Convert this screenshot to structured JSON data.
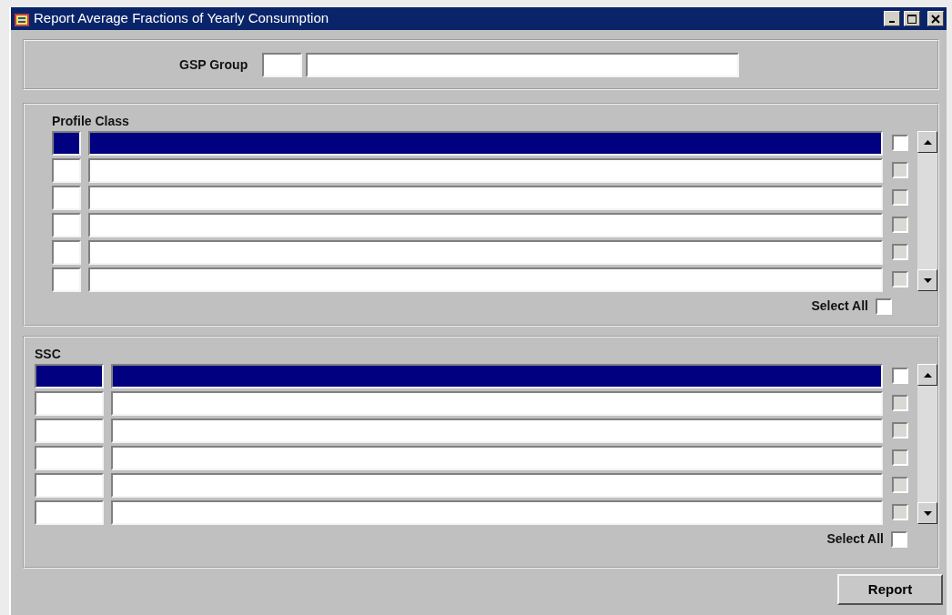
{
  "window": {
    "title": "Report Average Fractions of Yearly Consumption"
  },
  "gsp_group": {
    "label": "GSP Group"
  },
  "profile_class": {
    "label": "Profile Class",
    "rows": [
      {
        "selected": true,
        "checked": false,
        "disabled": false
      },
      {
        "selected": false,
        "checked": false,
        "disabled": true
      },
      {
        "selected": false,
        "checked": false,
        "disabled": true
      },
      {
        "selected": false,
        "checked": false,
        "disabled": true
      },
      {
        "selected": false,
        "checked": false,
        "disabled": true
      },
      {
        "selected": false,
        "checked": false,
        "disabled": true
      }
    ],
    "select_all": {
      "label": "Select All",
      "checked": false
    }
  },
  "ssc": {
    "label": "SSC",
    "rows": [
      {
        "selected": true,
        "checked": false,
        "disabled": false
      },
      {
        "selected": false,
        "checked": false,
        "disabled": true
      },
      {
        "selected": false,
        "checked": false,
        "disabled": true
      },
      {
        "selected": false,
        "checked": false,
        "disabled": true
      },
      {
        "selected": false,
        "checked": false,
        "disabled": true
      },
      {
        "selected": false,
        "checked": false,
        "disabled": true
      }
    ],
    "select_all": {
      "label": "Select All",
      "checked": false
    }
  },
  "buttons": [
    {
      "label": "Report"
    }
  ]
}
